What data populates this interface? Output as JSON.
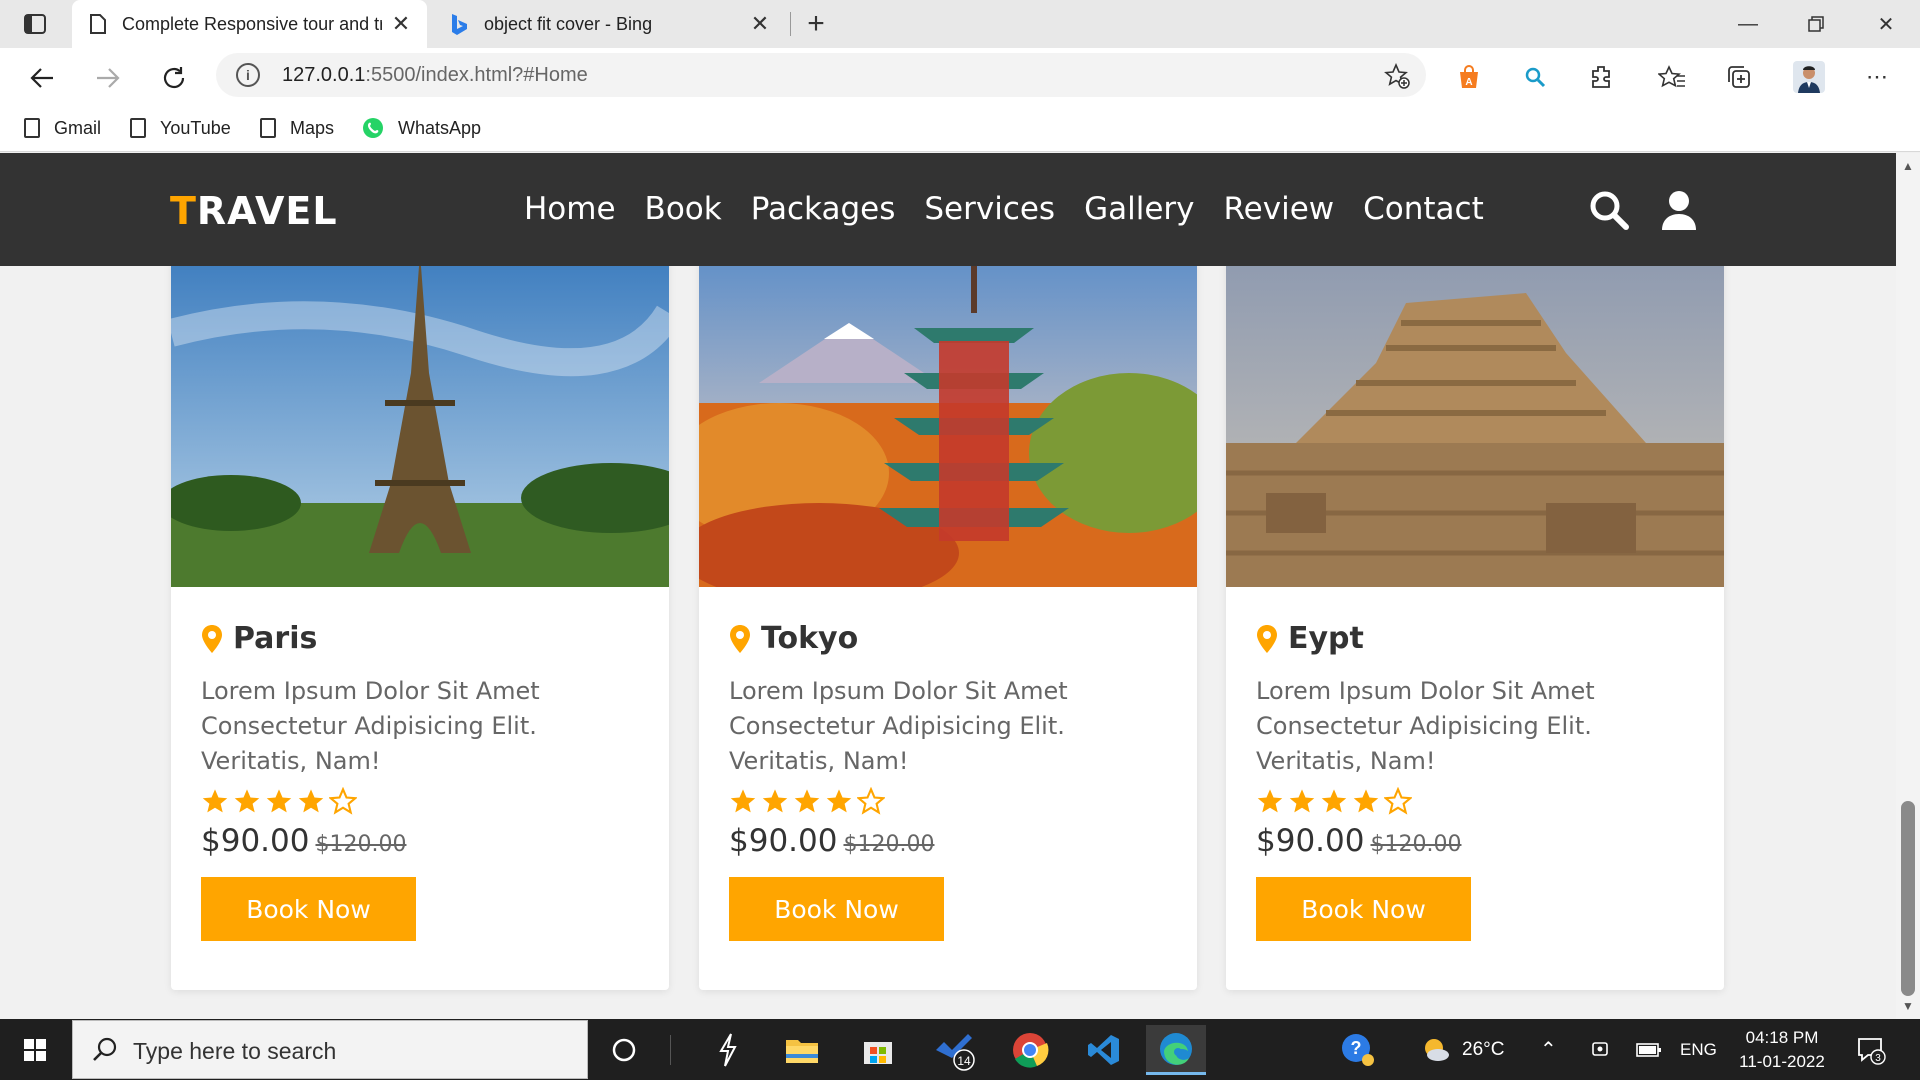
{
  "browser": {
    "tabs": [
      {
        "title": "Complete Responsive tour and tr",
        "active": true
      },
      {
        "title": "object fit cover - Bing",
        "active": false
      }
    ],
    "url_host": "127.0.0.1",
    "url_rest": ":5500/index.html?#Home",
    "profile_badge": "A",
    "bookmarks": [
      "Gmail",
      "YouTube",
      "Maps",
      "WhatsApp"
    ]
  },
  "site": {
    "logo_first": "T",
    "logo_rest": "RAVEL",
    "menu": [
      "Home",
      "Book",
      "Packages",
      "Services",
      "Gallery",
      "Review",
      "Contact"
    ],
    "accent_color": "#ffa500",
    "cards": [
      {
        "location": "Paris",
        "description": "Lorem Ipsum Dolor Sit Amet Consectetur Adipisicing Elit. Veritatis, Nam!",
        "rating": 4,
        "rating_max": 5,
        "price": "$90.00",
        "old_price": "$120.00",
        "button": "Book Now"
      },
      {
        "location": "Tokyo",
        "description": "Lorem Ipsum Dolor Sit Amet Consectetur Adipisicing Elit. Veritatis, Nam!",
        "rating": 4,
        "rating_max": 5,
        "price": "$90.00",
        "old_price": "$120.00",
        "button": "Book Now"
      },
      {
        "location": "Eypt",
        "description": "Lorem Ipsum Dolor Sit Amet Consectetur Adipisicing Elit. Veritatis, Nam!",
        "rating": 4,
        "rating_max": 5,
        "price": "$90.00",
        "old_price": "$120.00",
        "button": "Book Now"
      }
    ]
  },
  "taskbar": {
    "search_placeholder": "Type here to search",
    "todo_badge": "14",
    "weather": "26°C",
    "language": "ENG",
    "time": "04:18 PM",
    "date": "11-01-2022",
    "notifications": "3"
  }
}
